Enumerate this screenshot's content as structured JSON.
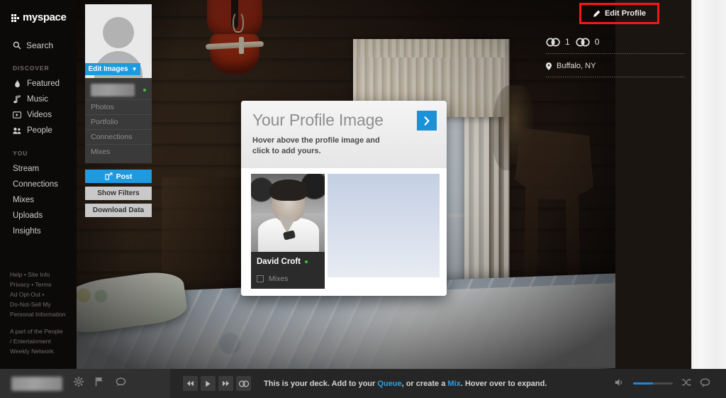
{
  "sidebar": {
    "logo_text": "myspace",
    "search": {
      "label": "Search",
      "icon": "search-icon"
    },
    "discover_heading": "DISCOVER",
    "discover_items": [
      {
        "label": "Featured",
        "icon": "flame-icon"
      },
      {
        "label": "Music",
        "icon": "music-note-icon"
      },
      {
        "label": "Videos",
        "icon": "video-icon"
      },
      {
        "label": "People",
        "icon": "people-icon"
      }
    ],
    "you_heading": "YOU",
    "you_items": [
      {
        "label": "Stream"
      },
      {
        "label": "Connections"
      },
      {
        "label": "Mixes"
      },
      {
        "label": "Uploads"
      },
      {
        "label": "Insights"
      }
    ],
    "footer": {
      "line1": "Help  •  Site Info",
      "line2": "Privacy  •  Terms",
      "line3": "Ad Opt-Out  •",
      "line4": "Do-Not-Sell My",
      "line5": "Personal Information",
      "network_line1": "A part of the People",
      "network_line2": "/ Entertainment",
      "network_line3": "Weekly Network."
    }
  },
  "profile_card": {
    "edit_images_label": "Edit Images",
    "edit_images_caret": "❯",
    "name_value": "",
    "online_status": "online",
    "links": [
      {
        "label": "Photos"
      },
      {
        "label": "Portfolio"
      },
      {
        "label": "Connections"
      },
      {
        "label": "Mixes"
      }
    ],
    "post_label": "Post",
    "show_filters_label": "Show Filters",
    "download_data_label": "Download Data"
  },
  "header": {
    "edit_profile_label": "Edit Profile",
    "edit_profile_icon": "pencil-icon",
    "highlight_color": "#fb1414"
  },
  "stats": {
    "connections": {
      "icon": "connections-icon",
      "count": "1"
    },
    "followers": {
      "icon": "connections-icon",
      "count": "0"
    },
    "location": {
      "icon": "location-pin-icon",
      "label": "Buffalo, NY"
    }
  },
  "tutorial_modal": {
    "title": "Your Profile Image",
    "subtitle": "Hover above the profile image and click to add yours.",
    "next_label": "❯",
    "next_icon": "chevron-right-icon",
    "demo_card": {
      "name": "David Croft",
      "status_dot": "online",
      "mixes_label": "Mixes",
      "mixes_icon": "mixes-icon"
    }
  },
  "player_bar": {
    "user_name_value": "",
    "icons": [
      {
        "name": "gear-icon"
      },
      {
        "name": "flag-icon"
      },
      {
        "name": "chat-icon"
      }
    ],
    "controls": [
      {
        "name": "previous-icon",
        "glyph": "◀◀"
      },
      {
        "name": "play-icon",
        "glyph": "▶"
      },
      {
        "name": "next-icon",
        "glyph": "▶▶"
      },
      {
        "name": "deck-icon",
        "glyph": "◎"
      }
    ],
    "deck_message_pre": "This is your deck. Add to your ",
    "deck_queue_link": "Queue",
    "deck_message_mid": ", or create a ",
    "deck_mix_link": "Mix",
    "deck_message_post": ". Hover over to expand.",
    "volume_icon": "speaker-icon",
    "volume_percent": "50",
    "shuffle_icon": "shuffle-icon",
    "repeat_icon": "repeat-icon",
    "accent_color": "#1e9ae0"
  }
}
